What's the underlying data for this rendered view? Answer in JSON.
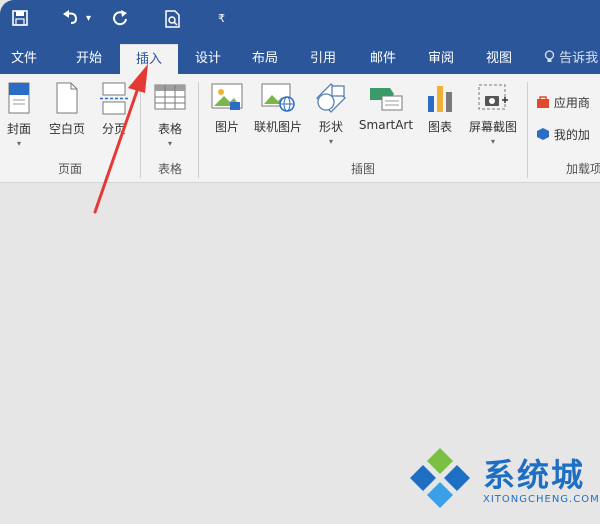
{
  "quick_access": {
    "save_icon": "save-icon",
    "undo_icon": "undo-icon",
    "dropdown_glyph": "▾",
    "redo_icon": "redo-icon",
    "print_preview_icon": "print-preview-icon",
    "customize_glyph": "₹"
  },
  "tabs": [
    {
      "label": "文件"
    },
    {
      "label": "开始"
    },
    {
      "label": "插入"
    },
    {
      "label": "设计"
    },
    {
      "label": "布局"
    },
    {
      "label": "引用"
    },
    {
      "label": "邮件"
    },
    {
      "label": "审阅"
    },
    {
      "label": "视图"
    }
  ],
  "tell_me": {
    "label": "告诉我"
  },
  "ribbon": {
    "pages": {
      "cover_label": "封面",
      "blank_label": "空白页",
      "break_label": "分页",
      "group_label": "页面"
    },
    "tables": {
      "table_label": "表格",
      "group_label": "表格"
    },
    "illustrations": {
      "picture_label": "图片",
      "online_picture_label": "联机图片",
      "shapes_label": "形状",
      "smartart_label": "SmartArt",
      "chart_label": "图表",
      "screenshot_label": "屏幕截图",
      "group_label": "插图"
    },
    "addins": {
      "store_label": "应用商",
      "my_addins_label": "我的加",
      "group_label": "加载项"
    }
  },
  "watermark": {
    "text": "系统城",
    "subtext": "XITONGCHENG.COM"
  },
  "colors": {
    "title_bar": "#2b579a",
    "ribbon_bg": "#f3f3f3",
    "arrow": "#e53935",
    "watermark": "#1e6fc4"
  }
}
